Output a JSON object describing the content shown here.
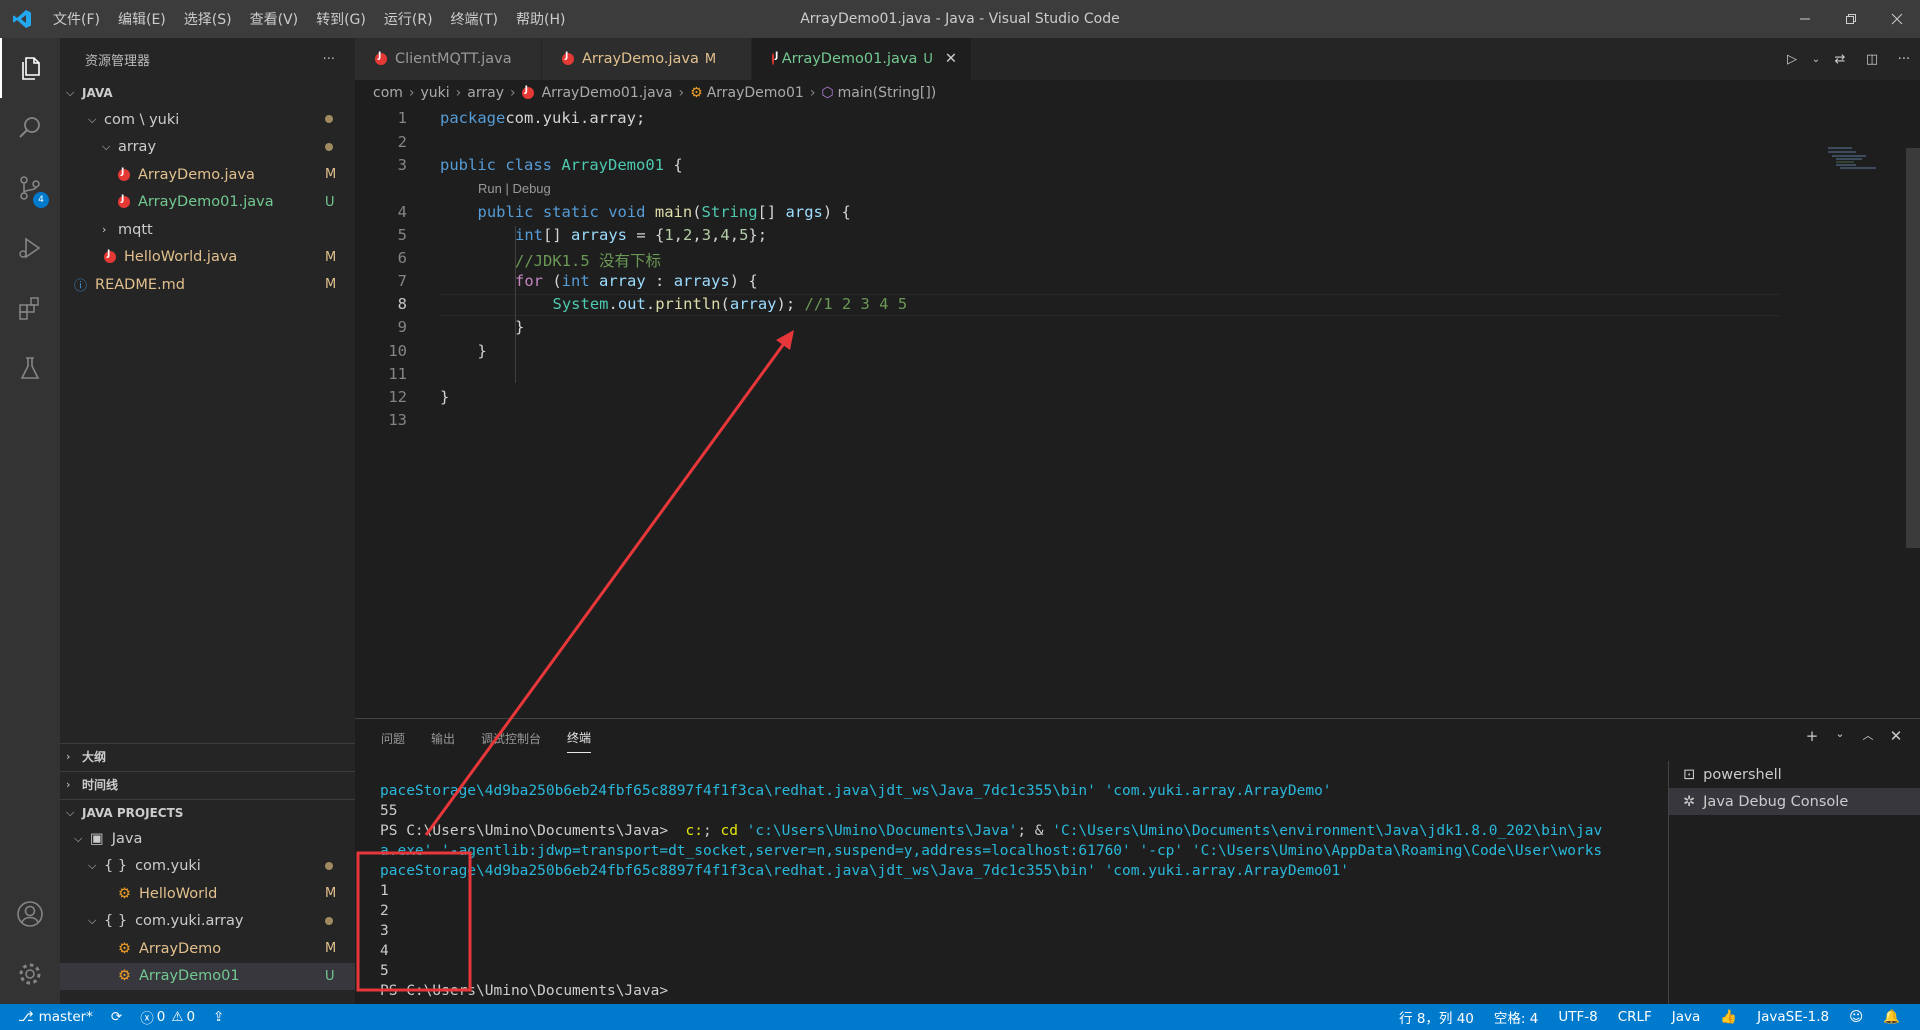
{
  "window": {
    "title": "ArrayDemo01.java - Java - Visual Studio Code"
  },
  "menu": [
    "文件(F)",
    "编辑(E)",
    "选择(S)",
    "查看(V)",
    "转到(G)",
    "运行(R)",
    "终端(T)",
    "帮助(H)"
  ],
  "activity": {
    "scm_badge": "4"
  },
  "sidebar": {
    "title": "资源管理器",
    "more": "···",
    "section_java": "JAVA",
    "tree": [
      {
        "label": "com \\ yuki",
        "status": "dot"
      },
      {
        "label": "array",
        "status": "dot"
      },
      {
        "label": "ArrayDemo.java",
        "status": "M"
      },
      {
        "label": "ArrayDemo01.java",
        "status": "U"
      },
      {
        "label": "mqtt",
        "status": ""
      },
      {
        "label": "HelloWorld.java",
        "status": "M"
      },
      {
        "label": "README.md",
        "status": "M"
      }
    ],
    "section_outline": "大纲",
    "section_timeline": "时间线",
    "section_projects": "JAVA PROJECTS",
    "projects": [
      {
        "label": "Java",
        "status": ""
      },
      {
        "label": "com.yuki",
        "status": "dot"
      },
      {
        "label": "HelloWorld",
        "status": "M"
      },
      {
        "label": "com.yuki.array",
        "status": "dot"
      },
      {
        "label": "ArrayDemo",
        "status": "M"
      },
      {
        "label": "ArrayDemo01",
        "status": "U"
      }
    ]
  },
  "tabs": [
    {
      "label": "ClientMQTT.java",
      "dirty": ""
    },
    {
      "label": "ArrayDemo.java",
      "dirty": "M"
    },
    {
      "label": "ArrayDemo01.java",
      "dirty": "U"
    }
  ],
  "breadcrumb": [
    "com",
    "yuki",
    "array",
    "ArrayDemo01.java",
    "ArrayDemo01",
    "main(String[])"
  ],
  "code": {
    "line_numbers": [
      "1",
      "2",
      "3",
      "4",
      "5",
      "6",
      "7",
      "8",
      "9",
      "10",
      "11",
      "12",
      "13"
    ],
    "codelens": "Run | Debug",
    "lines": [
      [
        [
          "kw",
          "package"
        ],
        [
          "",
          "com.yuki.array;"
        ]
      ],
      [],
      [
        [
          "kw",
          "public"
        ],
        [
          "",
          " "
        ],
        [
          "kw",
          "class"
        ],
        [
          "",
          " "
        ],
        [
          "ty",
          "ArrayDemo01"
        ],
        [
          "",
          " {"
        ]
      ],
      [
        [
          "",
          ""
        ],
        [
          "kw",
          "public"
        ],
        [
          "",
          " "
        ],
        [
          "kw",
          "static"
        ],
        [
          "",
          " "
        ],
        [
          "kw",
          "void"
        ],
        [
          "",
          " "
        ],
        [
          "fn",
          "main"
        ],
        [
          "",
          "("
        ],
        [
          "ty",
          "String"
        ],
        [
          "",
          "[] "
        ],
        [
          "va",
          "args"
        ],
        [
          "",
          ") {"
        ]
      ],
      [
        [
          "",
          ""
        ],
        [
          "kw",
          "int"
        ],
        [
          "",
          "[] "
        ],
        [
          "va",
          "arrays"
        ],
        [
          "",
          " = {"
        ],
        [
          "nu",
          "1"
        ],
        [
          "",
          ","
        ],
        [
          "nu",
          "2"
        ],
        [
          "",
          ","
        ],
        [
          "nu",
          "3"
        ],
        [
          "",
          ","
        ],
        [
          "nu",
          "4"
        ],
        [
          "",
          ","
        ],
        [
          "nu",
          "5"
        ],
        [
          "",
          "};"
        ]
      ],
      [
        [
          "",
          ""
        ],
        [
          "cm",
          "//JDK1.5 没有下标"
        ]
      ],
      [
        [
          "",
          ""
        ],
        [
          "kf",
          "for"
        ],
        [
          "",
          " ("
        ],
        [
          "kw",
          "int"
        ],
        [
          "",
          " "
        ],
        [
          "va",
          "array"
        ],
        [
          "",
          " : "
        ],
        [
          "va",
          "arrays"
        ],
        [
          "",
          ") {"
        ]
      ],
      [
        [
          "",
          ""
        ],
        [
          "ty",
          "System"
        ],
        [
          "",
          "."
        ],
        [
          "va",
          "out"
        ],
        [
          "",
          "."
        ],
        [
          "fn",
          "println"
        ],
        [
          "",
          "("
        ],
        [
          "va",
          "array"
        ],
        [
          "",
          "); "
        ],
        [
          "cm",
          "//1 2 3 4 5"
        ]
      ],
      [
        [
          "",
          ""
        ],
        [
          "",
          "}"
        ]
      ],
      [
        [
          "",
          ""
        ],
        [
          "",
          "}"
        ]
      ],
      [],
      [
        [
          "",
          "}"
        ]
      ],
      []
    ]
  },
  "panel": {
    "tabs": [
      "问题",
      "输出",
      "调试控制台",
      "终端"
    ],
    "terminals": [
      "powershell",
      "Java Debug Console"
    ],
    "term_lines": [
      [
        [
          "tc",
          "paceStorage\\4d9ba250b6eb24fbf65c8897f4f1f3ca\\redhat.java\\jdt_ws\\Java_7dc1c355\\bin' 'com.yuki.array.ArrayDemo'"
        ]
      ],
      [
        [
          "tw",
          "55"
        ]
      ],
      [
        [
          "tw",
          "PS C:\\Users\\Umino\\Documents\\Java>  "
        ],
        [
          "ty2",
          "c:"
        ],
        [
          "tw",
          "; "
        ],
        [
          "ty2",
          "cd"
        ],
        [
          "tc",
          " 'c:\\Users\\Umino\\Documents\\Java'"
        ],
        [
          "tw",
          "; & "
        ],
        [
          "tc",
          "'C:\\Users\\Umino\\Documents\\environment\\Java\\jdk1.8.0_202\\bin\\jav"
        ]
      ],
      [
        [
          "tc",
          "a.exe' '-agentlib:jdwp=transport=dt_socket,server=n,suspend=y,address=localhost:61760' '-cp' 'C:\\Users\\Umino\\AppData\\Roaming\\Code\\User\\works"
        ]
      ],
      [
        [
          "tc",
          "paceStorage\\4d9ba250b6eb24fbf65c8897f4f1f3ca\\redhat.java\\jdt_ws\\Java_7dc1c355\\bin' 'com.yuki.array.ArrayDemo01'"
        ]
      ],
      [
        [
          "tw",
          "1"
        ]
      ],
      [
        [
          "tw",
          "2"
        ]
      ],
      [
        [
          "tw",
          "3"
        ]
      ],
      [
        [
          "tw",
          "4"
        ]
      ],
      [
        [
          "tw",
          "5"
        ]
      ],
      [
        [
          "tw",
          "PS C:\\Users\\Umino\\Documents\\Java>"
        ]
      ]
    ]
  },
  "status": {
    "branch": "master*",
    "errors": "0",
    "warnings": "0",
    "position": "行 8，列 40",
    "spaces": "空格: 4",
    "encoding": "UTF-8",
    "eol": "CRLF",
    "language": "Java",
    "jdk": "JavaSE-1.8"
  },
  "colors": {
    "accent": "#007acc",
    "annotation": "#e8373a",
    "untracked": "#73c991",
    "modified": "#e2c08d"
  }
}
